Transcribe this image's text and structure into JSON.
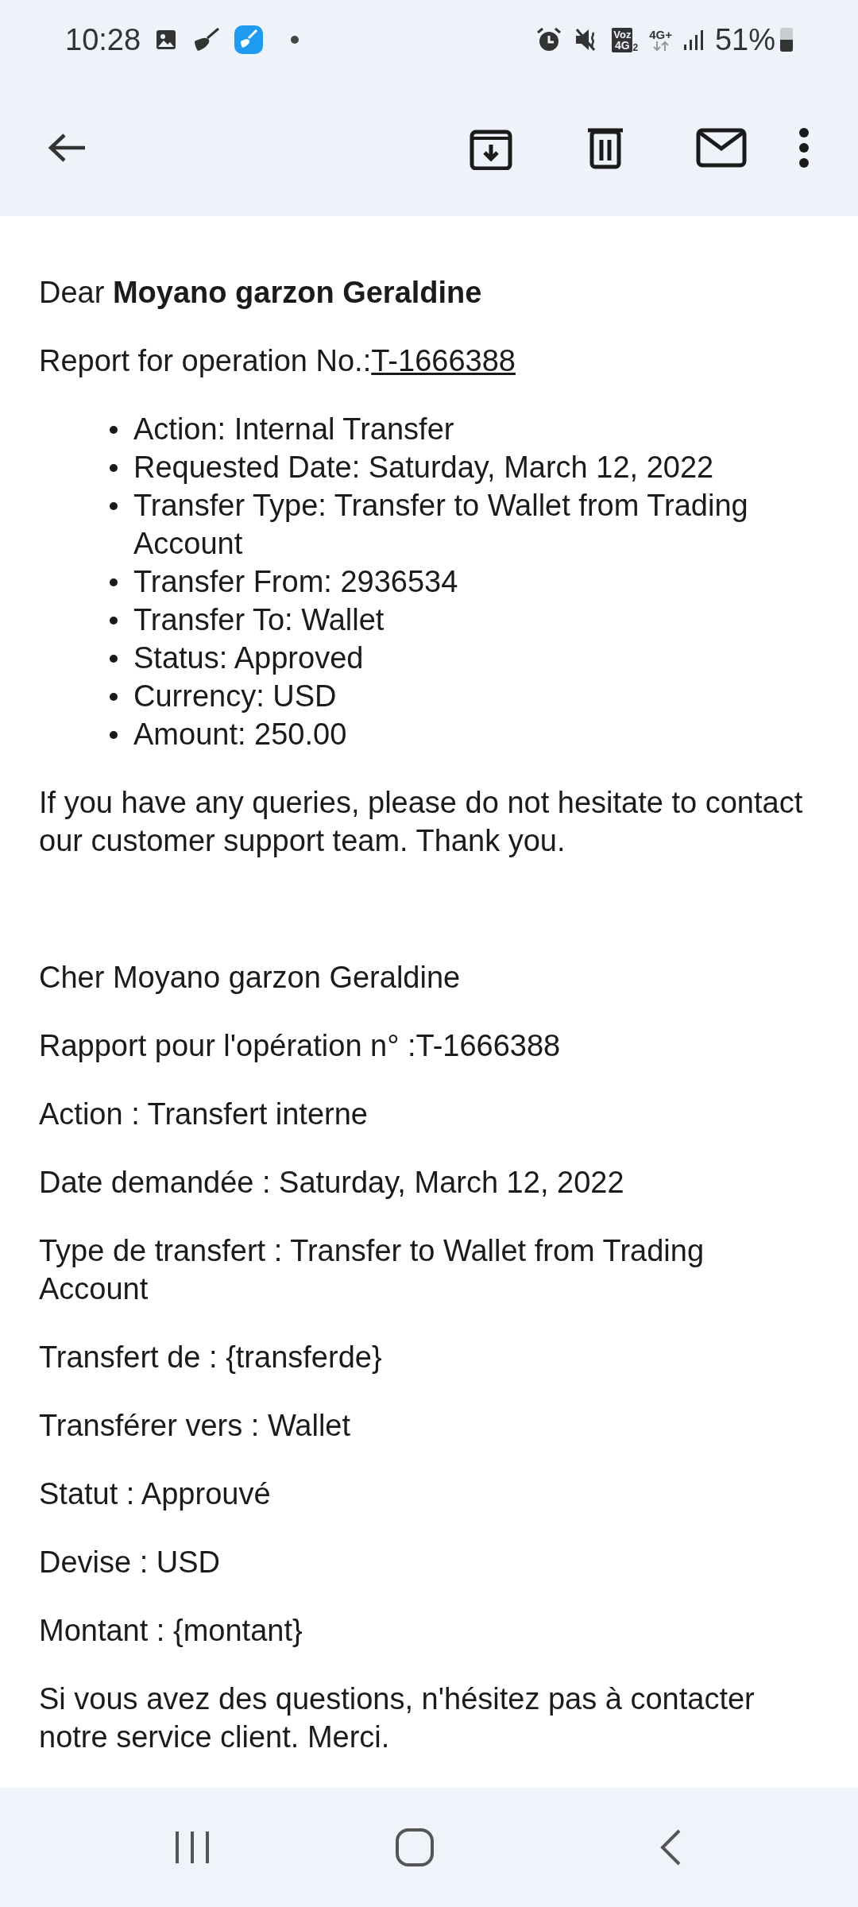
{
  "status_bar": {
    "time": "10:28",
    "volte_badge": "Voz",
    "volte_tech": "4G",
    "volte_sim": "2",
    "network": "4G+",
    "battery": "51%"
  },
  "email": {
    "english": {
      "greeting": "Dear **Moyano garzon Geraldine**",
      "report": {
        "text": "Report for operation No.:",
        "link": "T-1666388"
      },
      "details": [
        "Action: Internal Transfer",
        "Requested Date: Saturday, March 12, 2022",
        "Transfer Type: Transfer to Wallet from Trading Account",
        "Transfer From: 2936534",
        "Transfer To: Wallet",
        "Status: Approved",
        "Currency: USD",
        "Amount: 250.00"
      ],
      "closing": "If you have any queries, please do not hesitate to contact our customer support team. Thank you."
    },
    "french": {
      "paragraphs": [
        "Cher Moyano garzon Geraldine",
        "Rapport pour l'opération n° :T-1666388",
        "Action : Transfert interne",
        "Date demandée : Saturday, March 12, 2022",
        "Type de transfert : Transfer to Wallet from Trading Account",
        "Transfert de : {transferde}",
        "Transférer vers : Wallet",
        "Statut : Approuvé",
        "Devise : USD",
        "Montant : {montant}",
        "Si vous avez des questions, n'hésitez pas à contacter notre service client. Merci."
      ]
    }
  }
}
